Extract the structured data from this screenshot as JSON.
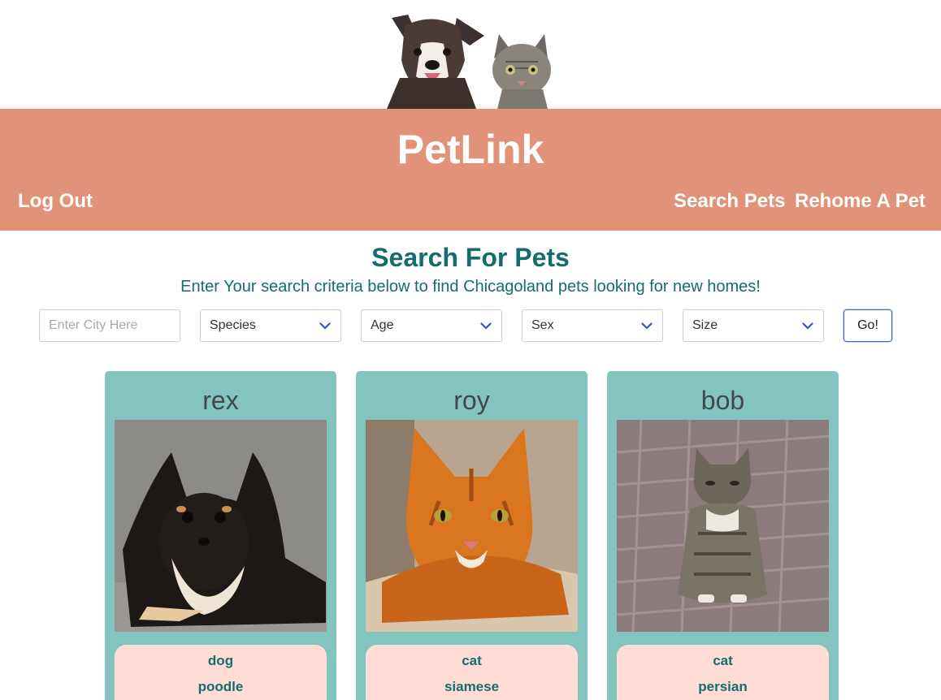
{
  "header": {
    "brand": "PetLink",
    "logout_label": "Log Out",
    "search_pets_label": "Search Pets",
    "rehome_label": "Rehome A Pet"
  },
  "search": {
    "title": "Search For Pets",
    "subtitle": "Enter Your search criteria below to find Chicagoland pets looking for new homes!",
    "city_placeholder": "Enter City Here",
    "species_label": "Species",
    "age_label": "Age",
    "sex_label": "Sex",
    "size_label": "Size",
    "go_label": "Go!"
  },
  "pets": [
    {
      "name": "rex",
      "species": "dog",
      "breed": "poodle"
    },
    {
      "name": "roy",
      "species": "cat",
      "breed": "siamese"
    },
    {
      "name": "bob",
      "species": "cat",
      "breed": "persian"
    }
  ],
  "colors": {
    "banner": "#e19279",
    "accent_text": "#156d6b",
    "card": "#84c4be",
    "card_info": "#ffddd5"
  }
}
